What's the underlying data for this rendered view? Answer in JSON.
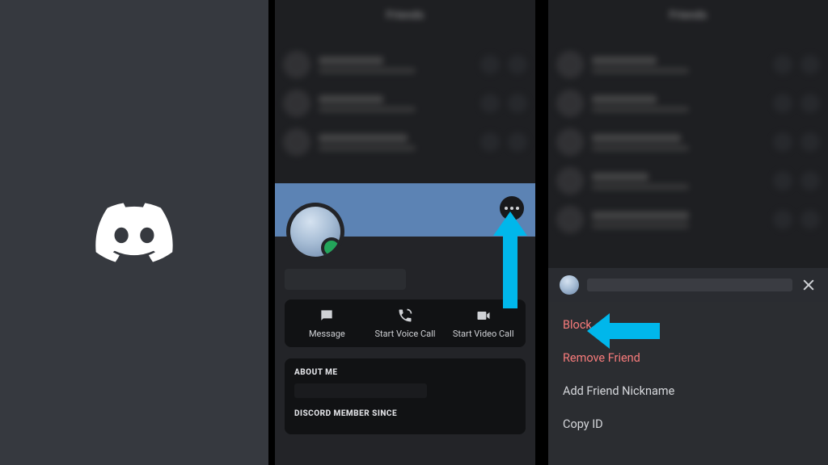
{
  "header": {
    "title": "Friends"
  },
  "profile": {
    "actions": {
      "message": "Message",
      "voice": "Start Voice Call",
      "video": "Start Video Call"
    },
    "sections": {
      "about_me": "ABOUT ME",
      "member_since": "DISCORD MEMBER SINCE"
    }
  },
  "menu": {
    "block": "Block",
    "remove_friend": "Remove Friend",
    "add_nickname": "Add Friend Nickname",
    "copy_id": "Copy ID"
  }
}
